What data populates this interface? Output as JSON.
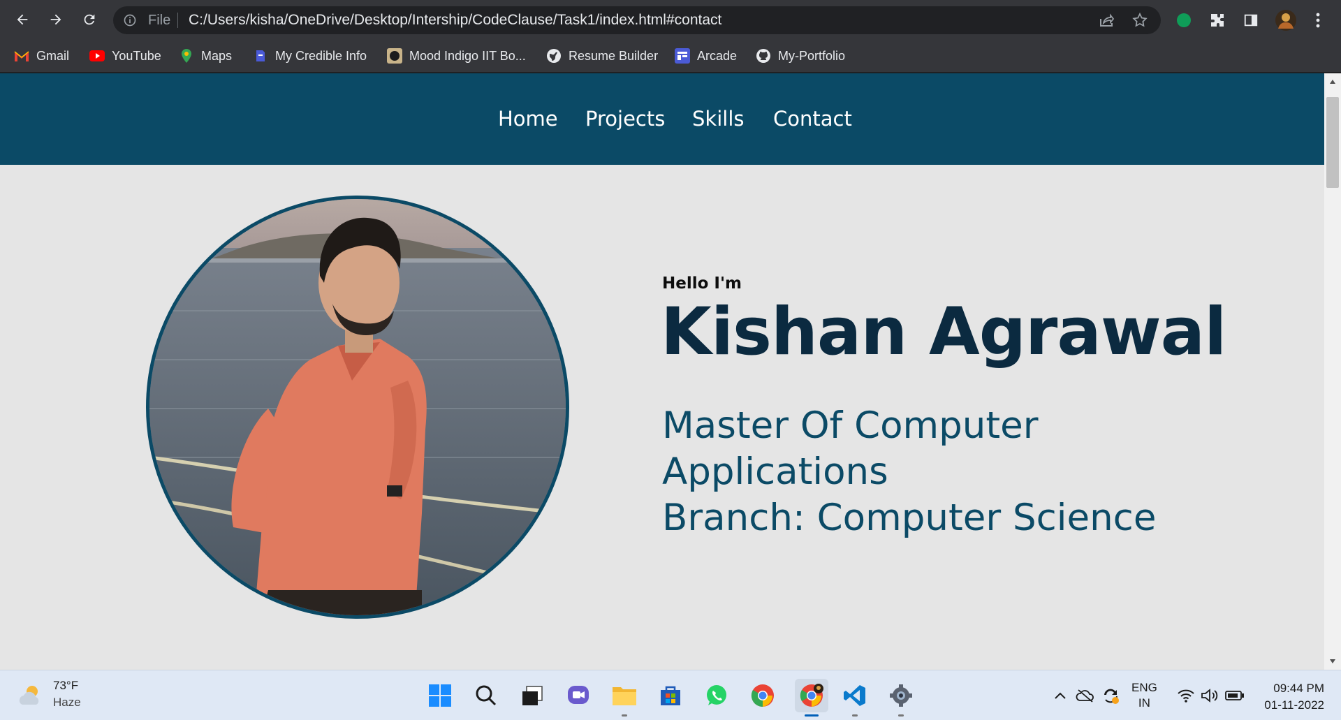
{
  "browser": {
    "omnibox": {
      "scheme_label": "File",
      "url": "C:/Users/kisha/OneDrive/Desktop/Intership/CodeClause/Task1/index.html#contact"
    },
    "bookmarks": [
      {
        "label": "Gmail",
        "icon": "gmail-icon"
      },
      {
        "label": "YouTube",
        "icon": "youtube-icon"
      },
      {
        "label": "Maps",
        "icon": "maps-icon"
      },
      {
        "label": "My Credible Info",
        "icon": "credible-info-icon"
      },
      {
        "label": "Mood Indigo IIT Bo...",
        "icon": "mood-indigo-icon"
      },
      {
        "label": "Resume Builder",
        "icon": "globe-icon"
      },
      {
        "label": "Arcade",
        "icon": "arcade-icon"
      },
      {
        "label": "My-Portfolio",
        "icon": "github-icon"
      }
    ]
  },
  "site": {
    "nav": [
      "Home",
      "Projects",
      "Skills",
      "Contact"
    ],
    "hero": {
      "greeting": "Hello I'm",
      "name": "Kishan Agrawal",
      "lines": [
        "Master Of Computer",
        "Applications",
        "Branch: Computer Science"
      ]
    },
    "colors": {
      "nav_bg": "#0b4a66",
      "name": "#0b2a40",
      "subtitle": "#0b4a66",
      "page_bg": "#e5e5e5"
    }
  },
  "taskbar": {
    "weather": {
      "temp": "73°F",
      "desc": "Haze"
    },
    "apps": [
      "start-icon",
      "search-icon",
      "task-view-icon",
      "chat-icon",
      "file-explorer-icon",
      "store-icon",
      "whatsapp-icon",
      "chrome-icon",
      "chrome-profile-icon",
      "vscode-icon",
      "settings-icon"
    ],
    "language": {
      "line1": "ENG",
      "line2": "IN"
    },
    "clock": {
      "time": "09:44 PM",
      "date": "01-11-2022"
    }
  }
}
